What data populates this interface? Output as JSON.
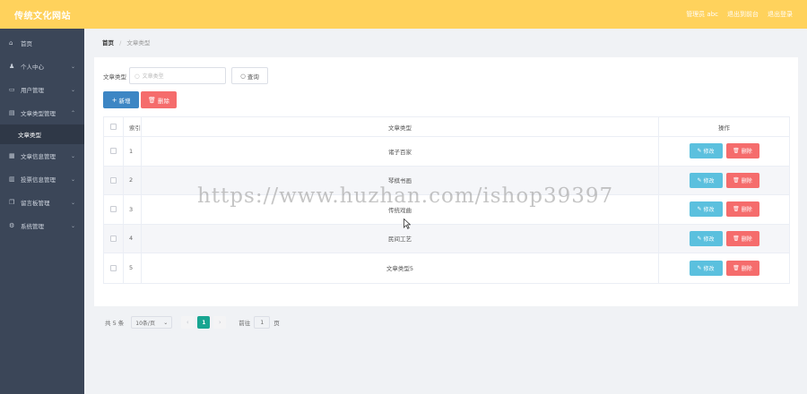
{
  "header": {
    "site_title": "传统文化网站",
    "links": [
      "管理员 abc",
      "退出到前台",
      "退出登录"
    ]
  },
  "sidebar": {
    "items": [
      {
        "label": "首页",
        "icon": "home-icon",
        "glyph": "⌂"
      },
      {
        "label": "个人中心",
        "icon": "user-icon",
        "glyph": "♟"
      },
      {
        "label": "用户管理",
        "icon": "id-card-icon",
        "glyph": "▭"
      },
      {
        "label": "文章类型管理",
        "icon": "document-icon",
        "glyph": "▤"
      },
      {
        "label": "文章类型",
        "sub": true
      },
      {
        "label": "文章信息管理",
        "icon": "grid-icon",
        "glyph": "▦"
      },
      {
        "label": "投票信息管理",
        "icon": "building-icon",
        "glyph": "▥"
      },
      {
        "label": "留言板管理",
        "icon": "copy-icon",
        "glyph": "❐"
      },
      {
        "label": "系统管理",
        "icon": "settings-icon",
        "glyph": "⚙"
      }
    ]
  },
  "breadcrumb": {
    "home": "首页",
    "separator": "/",
    "current": "文章类型"
  },
  "search": {
    "label": "文章类型",
    "placeholder": "文章类型",
    "button": "查询"
  },
  "actions": {
    "add": "新增",
    "delete": "删除"
  },
  "table": {
    "headers": {
      "index": "索引",
      "type": "文章类型",
      "ops": "操作"
    },
    "edit_label": "修改",
    "delete_label": "删除",
    "rows": [
      {
        "index": "1",
        "type": "诸子百家"
      },
      {
        "index": "2",
        "type": "琴棋书画"
      },
      {
        "index": "3",
        "type": "传统戏曲"
      },
      {
        "index": "4",
        "type": "民间工艺"
      },
      {
        "index": "5",
        "type": "文章类型5"
      }
    ]
  },
  "pagination": {
    "total": "共 5 条",
    "page_size": "10条/页",
    "current_page": "1",
    "goto_label": "前往",
    "goto_value": "1",
    "page_suffix": "页"
  },
  "watermark": "https://www.huzhan.com/ishop39397",
  "colors": {
    "header": "#ffd25c",
    "sidebar": "#3b4658",
    "add": "#3d86c4",
    "delete": "#f56c6c",
    "edit": "#5bc0de",
    "active_page": "#18a591"
  }
}
